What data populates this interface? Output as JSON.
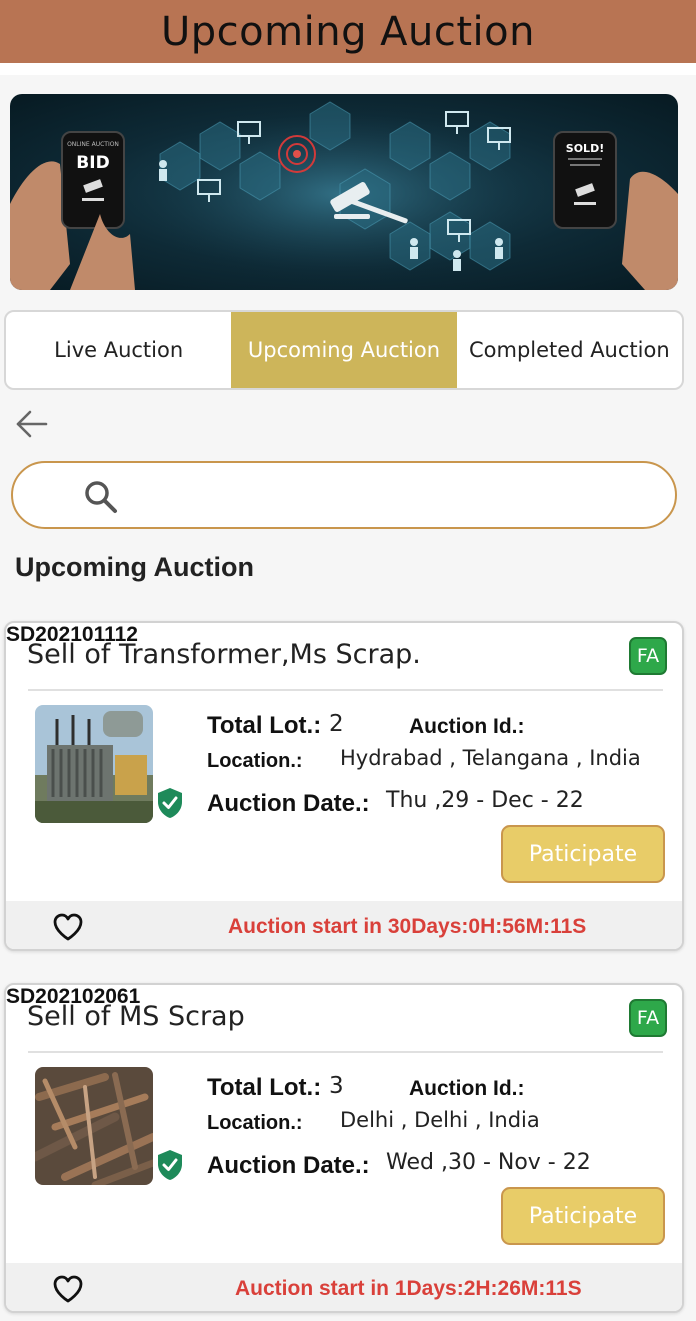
{
  "header": {
    "title": "Upcoming Auction"
  },
  "banner": {
    "left_phone_text": "BID",
    "left_phone_subtext": "ONLINE AUCTION",
    "right_phone_text": "SOLD!"
  },
  "tabs": [
    {
      "label": "Live Auction",
      "active": false
    },
    {
      "label": "Upcoming Auction",
      "active": true
    },
    {
      "label": "Completed Auction",
      "active": false
    }
  ],
  "search": {
    "placeholder": "",
    "value": ""
  },
  "section_title": "Upcoming Auction",
  "colors": {
    "header_bg": "#b87453",
    "tab_active": "#cdb55a",
    "search_border": "#c9964d",
    "participate_bg": "#e8cc68",
    "countdown_text": "#d9403a",
    "badge_green": "#2ea84a",
    "verified_green": "#1e8a5a"
  },
  "auctions": [
    {
      "title": "Sell of Transformer,Ms Scrap.",
      "badge": "FA",
      "thumbnail": "transformer-image",
      "total_lot_label": "Total Lot.:",
      "total_lot": "2",
      "auction_id_label": "Auction Id.:",
      "auction_id": "SD202101112",
      "location_label": "Location.:",
      "location": "Hydrabad ,  Telangana , India",
      "date_label": "Auction Date.:",
      "date": "Thu ,29 - Dec - 22",
      "button_label": "Paticipate",
      "countdown": "Auction start in 30Days:0H:56M:11S"
    },
    {
      "title": "Sell of MS Scrap",
      "badge": "FA",
      "thumbnail": "scrap-metal-image",
      "total_lot_label": "Total Lot.:",
      "total_lot": "3",
      "auction_id_label": "Auction Id.:",
      "auction_id": "SD202102061",
      "location_label": "Location.:",
      "location": "Delhi ,  Delhi , India",
      "date_label": "Auction Date.:",
      "date": "Wed ,30 - Nov - 22",
      "button_label": "Paticipate",
      "countdown": "Auction start in 1Days:2H:26M:11S"
    }
  ]
}
